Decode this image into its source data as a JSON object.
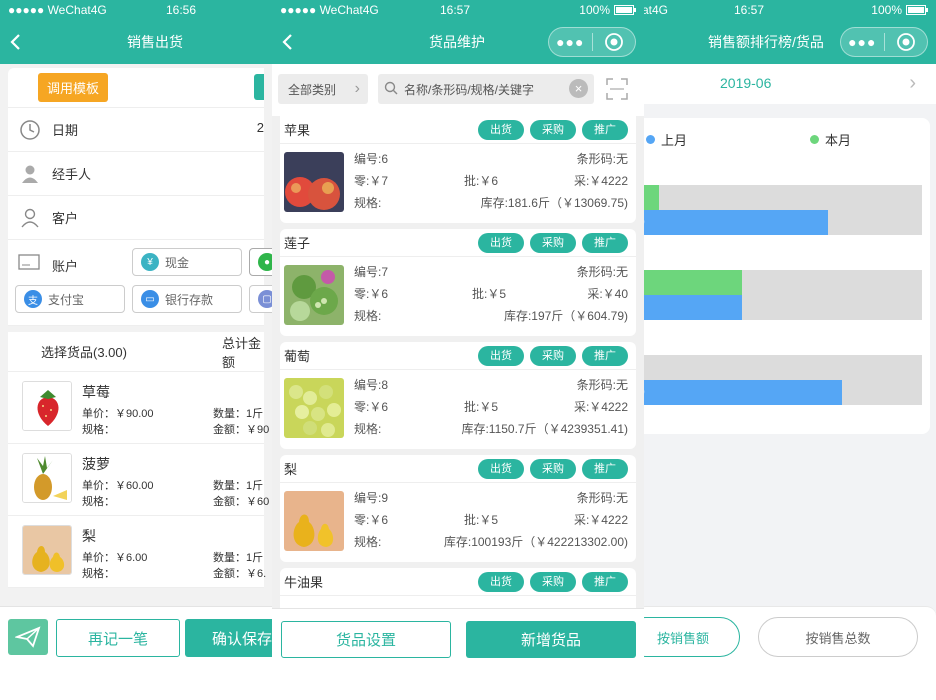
{
  "screens": {
    "sale": {
      "status": {
        "carrier": "●●●●● WeChat4G",
        "time": "16:56"
      },
      "title": "销售出货",
      "template_button": "调用模板",
      "fields": {
        "date": "日期",
        "date_value_partial": "2",
        "handler": "经手人",
        "customer": "客户",
        "account": "账户"
      },
      "payment_methods": {
        "cash": "现金",
        "alipay": "支付宝",
        "bank": "银行存款"
      },
      "selected_header": "选择货品(3.00)",
      "total_header": "总计金额",
      "goods": [
        {
          "name": "草莓",
          "price": "单价：￥90.00",
          "spec": "规格：",
          "qty": "数量：1斤",
          "amount": "金额：￥90"
        },
        {
          "name": "菠萝",
          "price": "单价：￥60.00",
          "spec": "规格：",
          "qty": "数量：1斤",
          "amount": "金额：￥60"
        },
        {
          "name": "梨",
          "price": "单价：￥6.00",
          "spec": "规格：",
          "qty": "数量：1斤",
          "amount": "金额：￥6."
        }
      ],
      "again_button": "再记一笔",
      "confirm_button": "确认保存"
    },
    "goods": {
      "status": {
        "carrier": "●●●●● WeChat4G",
        "time": "16:57",
        "battery": "100%"
      },
      "title": "货品维护",
      "category": "全部类别",
      "search_placeholder": "名称/条形码/规格/关键字",
      "buttons": {
        "out": "出货",
        "purchase": "采购",
        "promote": "推广"
      },
      "products": [
        {
          "name": "苹果",
          "code": "编号:6",
          "barcode": "条形码:无",
          "retail": "零:￥7",
          "wholesale": "批:￥6",
          "cost": "采:￥4222",
          "spec": "规格:",
          "stock": "库存:181.6斤（￥13069.75)"
        },
        {
          "name": "莲子",
          "code": "编号:7",
          "barcode": "条形码:无",
          "retail": "零:￥6",
          "wholesale": "批:￥5",
          "cost": "采:￥40",
          "spec": "规格:",
          "stock": "库存:197斤（￥604.79)"
        },
        {
          "name": "葡萄",
          "code": "编号:8",
          "barcode": "条形码:无",
          "retail": "零:￥6",
          "wholesale": "批:￥5",
          "cost": "采:￥4222",
          "spec": "规格:",
          "stock": "库存:1150.7斤（￥4239351.41)"
        },
        {
          "name": "梨",
          "code": "编号:9",
          "barcode": "条形码:无",
          "retail": "零:￥6",
          "wholesale": "批:￥5",
          "cost": "采:￥4222",
          "spec": "规格:",
          "stock": "库存:100193斤（￥422213302.00)"
        },
        {
          "name": "牛油果"
        }
      ],
      "settings_button": "货品设置",
      "new_button": "新增货品"
    },
    "ranking": {
      "status": {
        "carrier": "at4G",
        "time": "16:57",
        "battery": "100%"
      },
      "title": "销售额排行榜/货品",
      "month": "2019-06",
      "legend": {
        "last_month": "上月",
        "this_month": "本月"
      },
      "colors": {
        "last_month": "#55a6f5",
        "this_month": "#6dd67c"
      },
      "by_amount": "按销售额",
      "by_total": "按销售总数"
    }
  },
  "chart_data": {
    "type": "bar",
    "orientation": "horizontal",
    "series": [
      {
        "name": "本月",
        "values": [
          0.08,
          0.37,
          0.01
        ]
      },
      {
        "name": "上月",
        "values": [
          0.67,
          0.37,
          0.72
        ]
      }
    ],
    "data_labels": [
      "0",
      "",
      "0"
    ],
    "legend_position": "top"
  }
}
